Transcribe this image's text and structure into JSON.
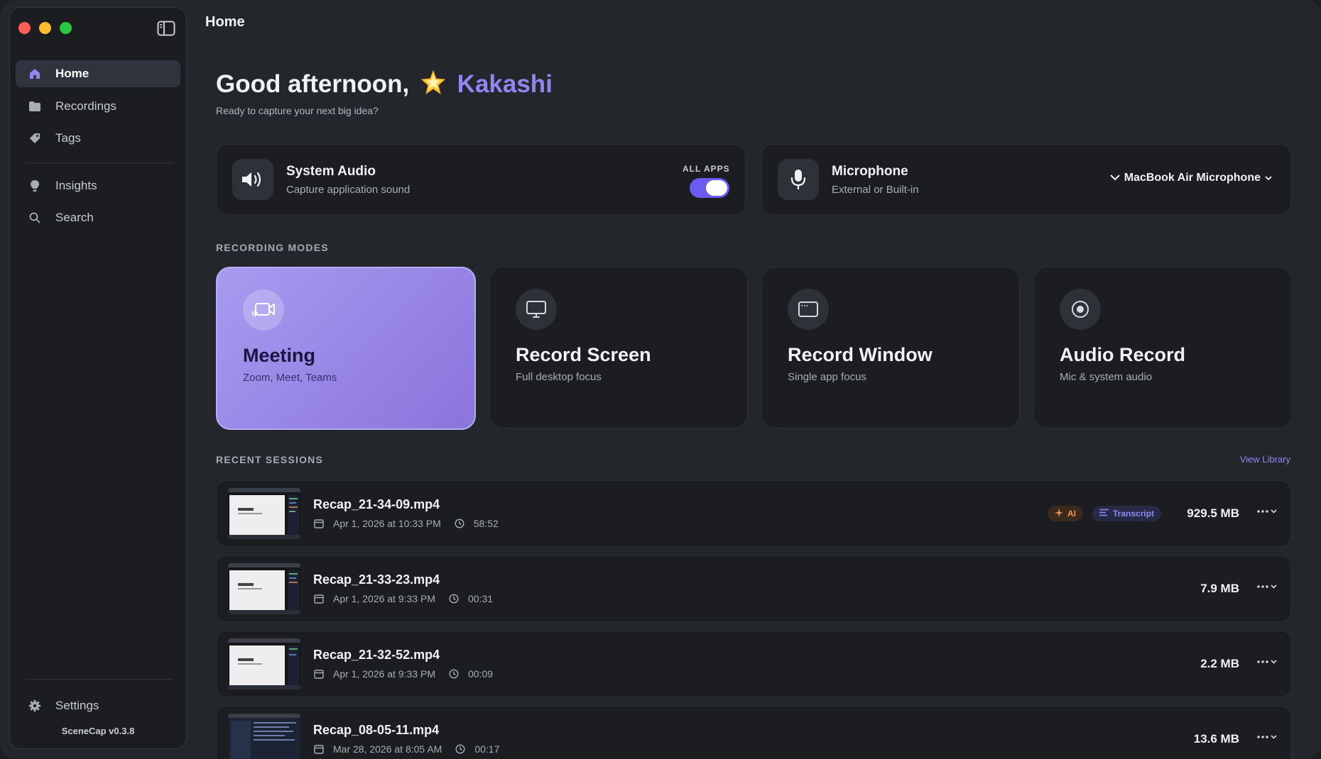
{
  "window": {
    "title": "Home"
  },
  "sidebar": {
    "toggle_icon": "sidebar-toggle-icon",
    "items": [
      {
        "label": "Home",
        "icon": "house-icon",
        "active": true
      },
      {
        "label": "Recordings",
        "icon": "folder-icon"
      },
      {
        "label": "Tags",
        "icon": "tag-icon"
      },
      {
        "label": "Insights",
        "icon": "lightbulb-icon"
      },
      {
        "label": "Search",
        "icon": "search-icon"
      }
    ],
    "settings_label": "Settings",
    "version": "SceneCap v0.3.8"
  },
  "greeting": {
    "prefix": "Good afternoon,",
    "name": "Kakashi",
    "subtitle": "Ready to capture your next big idea?"
  },
  "system_audio": {
    "title": "System Audio",
    "subtitle": "Capture application sound",
    "toggle_label": "ALL APPS",
    "enabled": true
  },
  "microphone": {
    "title": "Microphone",
    "subtitle": "External or Built-in",
    "selected": "MacBook Air Microphone"
  },
  "recording_modes": {
    "heading": "RECORDING MODES",
    "modes": [
      {
        "title": "Meeting",
        "subtitle": "Zoom, Meet, Teams",
        "icon": "video-camera-icon",
        "active": true
      },
      {
        "title": "Record Screen",
        "subtitle": "Full desktop focus",
        "icon": "monitor-icon"
      },
      {
        "title": "Record Window",
        "subtitle": "Single app focus",
        "icon": "window-icon"
      },
      {
        "title": "Audio Record",
        "subtitle": "Mic & system audio",
        "icon": "record-icon"
      }
    ]
  },
  "recent": {
    "heading": "RECENT SESSIONS",
    "view_library": "View Library",
    "sessions": [
      {
        "name": "Recap_21-34-09.mp4",
        "date": "Apr 1, 2026 at 10:33 PM",
        "duration": "58:52",
        "size": "929.5 MB",
        "badges": [
          "AI",
          "Transcript"
        ]
      },
      {
        "name": "Recap_21-33-23.mp4",
        "date": "Apr 1, 2026 at 9:33 PM",
        "duration": "00:31",
        "size": "7.9 MB"
      },
      {
        "name": "Recap_21-32-52.mp4",
        "date": "Apr 1, 2026 at 9:33 PM",
        "duration": "00:09",
        "size": "2.2 MB"
      },
      {
        "name": "Recap_08-05-11.mp4",
        "date": "Mar 28, 2026 at 8:05 AM",
        "duration": "00:17",
        "size": "13.6 MB"
      }
    ]
  },
  "colors": {
    "accent": "#8f86f2",
    "toggle_on": "#6a5cf0",
    "meeting_card": "#9d8ae8",
    "ai_badge": "#f0934a"
  }
}
